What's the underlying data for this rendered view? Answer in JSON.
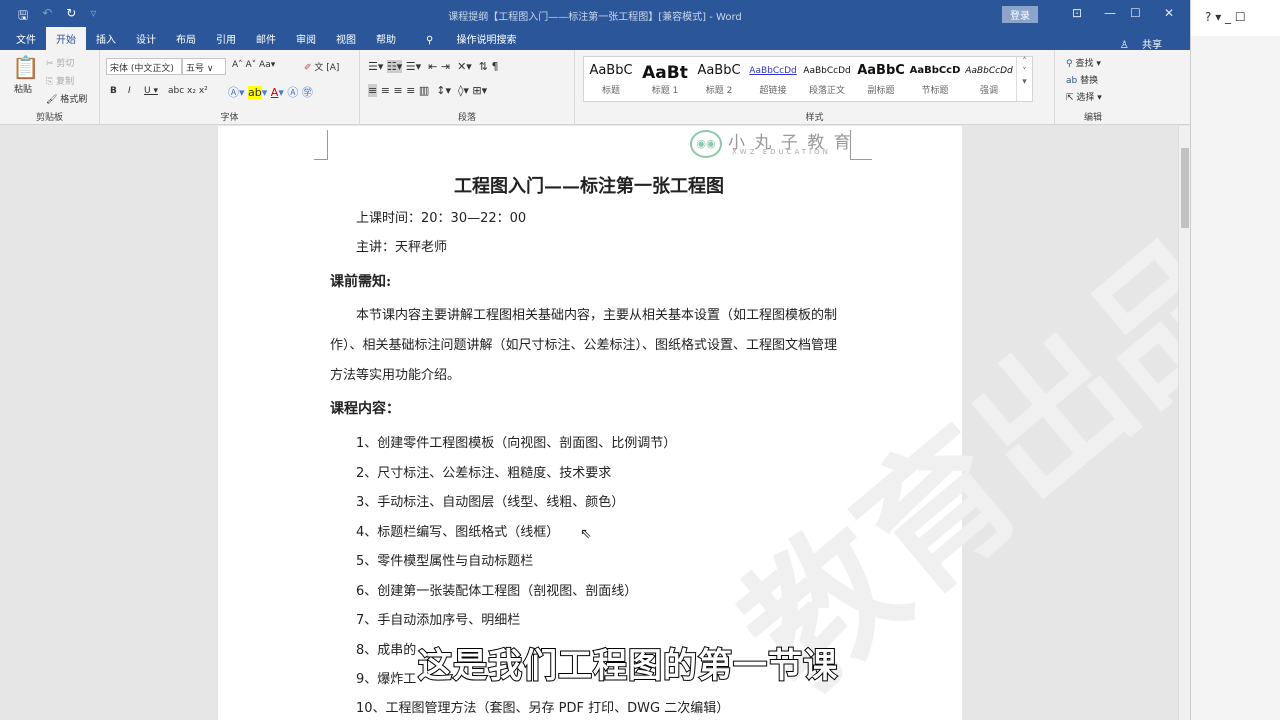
{
  "window": {
    "title": "课程提纲【工程图入门——标注第一张工程图】[兼容模式] - Word",
    "login": "登录",
    "share": "共享"
  },
  "tabs": [
    "文件",
    "开始",
    "插入",
    "设计",
    "布局",
    "引用",
    "邮件",
    "审阅",
    "视图",
    "帮助",
    "操作说明搜索"
  ],
  "clipboard": {
    "paste": "粘贴",
    "cut": "剪切",
    "copy": "复制",
    "format_painter": "格式刷",
    "label": "剪贴板"
  },
  "font": {
    "name": "宋体 (中文正文)",
    "size": "五号",
    "label": "字体"
  },
  "paragraph": {
    "label": "段落"
  },
  "styles": {
    "label": "样式",
    "items": [
      {
        "sample": "AaBbC",
        "name": "标题"
      },
      {
        "sample": "AaBt",
        "name": "标题 1"
      },
      {
        "sample": "AaBbC",
        "name": "标题 2"
      },
      {
        "sample": "AaBbCcDd",
        "name": "超链接"
      },
      {
        "sample": "AaBbCcDd",
        "name": "段落正文"
      },
      {
        "sample": "AaBbC",
        "name": "副标题"
      },
      {
        "sample": "AaBbCcD",
        "name": "节标题"
      },
      {
        "sample": "AaBbCcDd",
        "name": "强调"
      }
    ]
  },
  "editing": {
    "find": "查找",
    "replace": "替换",
    "select": "选择",
    "label": "编辑"
  },
  "document": {
    "logo": "小 丸 子 教 育",
    "logo_sub": "XWZ EDUCATION",
    "title": "工程图入门——标注第一张工程图",
    "time": "上课时间：20：30—22：00",
    "teacher": "主讲：天秤老师",
    "notice_heading": "课前需知:",
    "notice_lines": [
      "本节课内容主要讲解工程图相关基础内容，主要从相关基本设置（如工程图模板的制",
      "作）、相关基础标注问题讲解（如尺寸标注、公差标注）、图纸格式设置、工程图文档管理",
      "方法等实用功能介绍。"
    ],
    "content_heading": "课程内容：",
    "items": [
      "1、创建零件工程图模板（向视图、剖面图、比例调节）",
      "2、尺寸标注、公差标注、粗糙度、技术要求",
      "3、手动标注、自动图层（线型、线粗、颜色）",
      "4、标题栏编写、图纸格式（线框）",
      "5、零件模型属性与自动标题栏",
      "6、创建第一张装配体工程图（剖视图、剖面线）",
      "7、手自动添加序号、明细栏",
      "8、成串的",
      "9、爆炸工",
      "10、工程图管理方法（套图、另存 PDF 打印、DWG 二次编辑）"
    ]
  },
  "subtitle": "这是我们工程图的第一节课",
  "other_window": {
    "help": "?"
  }
}
